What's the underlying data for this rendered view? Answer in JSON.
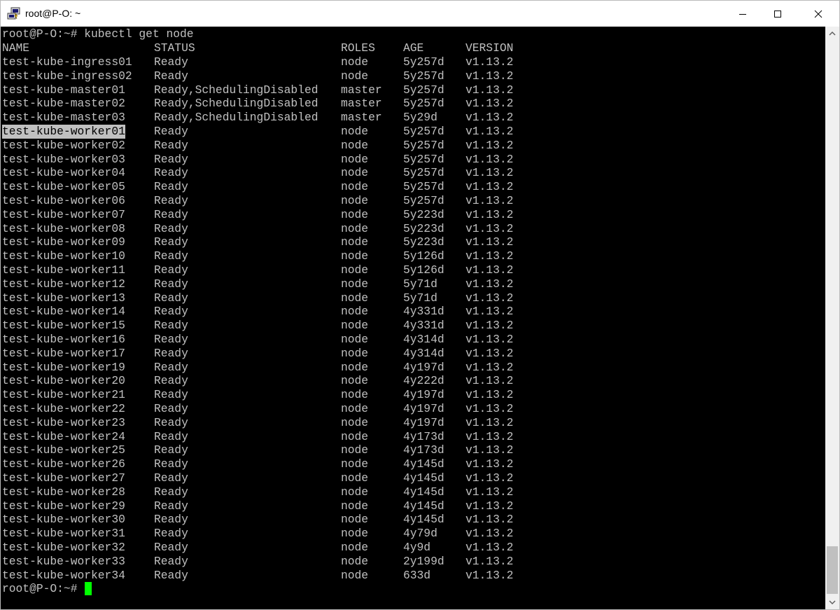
{
  "window": {
    "title": "root@P-O: ~"
  },
  "terminal": {
    "command_prompt": "root@P-O:~# ",
    "command": "kubectl get node",
    "headers": {
      "name": "NAME",
      "status": "STATUS",
      "roles": "ROLES",
      "age": "AGE",
      "version": "VERSION"
    },
    "rows": [
      {
        "name": "test-kube-ingress01",
        "status": "Ready",
        "roles": "node",
        "age": "5y257d",
        "version": "v1.13.2"
      },
      {
        "name": "test-kube-ingress02",
        "status": "Ready",
        "roles": "node",
        "age": "5y257d",
        "version": "v1.13.2"
      },
      {
        "name": "test-kube-master01",
        "status": "Ready,SchedulingDisabled",
        "roles": "master",
        "age": "5y257d",
        "version": "v1.13.2"
      },
      {
        "name": "test-kube-master02",
        "status": "Ready,SchedulingDisabled",
        "roles": "master",
        "age": "5y257d",
        "version": "v1.13.2"
      },
      {
        "name": "test-kube-master03",
        "status": "Ready,SchedulingDisabled",
        "roles": "master",
        "age": "5y29d",
        "version": "v1.13.2"
      },
      {
        "name": "test-kube-worker01",
        "status": "Ready",
        "roles": "node",
        "age": "5y257d",
        "version": "v1.13.2",
        "selected": true
      },
      {
        "name": "test-kube-worker02",
        "status": "Ready",
        "roles": "node",
        "age": "5y257d",
        "version": "v1.13.2"
      },
      {
        "name": "test-kube-worker03",
        "status": "Ready",
        "roles": "node",
        "age": "5y257d",
        "version": "v1.13.2"
      },
      {
        "name": "test-kube-worker04",
        "status": "Ready",
        "roles": "node",
        "age": "5y257d",
        "version": "v1.13.2"
      },
      {
        "name": "test-kube-worker05",
        "status": "Ready",
        "roles": "node",
        "age": "5y257d",
        "version": "v1.13.2"
      },
      {
        "name": "test-kube-worker06",
        "status": "Ready",
        "roles": "node",
        "age": "5y257d",
        "version": "v1.13.2"
      },
      {
        "name": "test-kube-worker07",
        "status": "Ready",
        "roles": "node",
        "age": "5y223d",
        "version": "v1.13.2"
      },
      {
        "name": "test-kube-worker08",
        "status": "Ready",
        "roles": "node",
        "age": "5y223d",
        "version": "v1.13.2"
      },
      {
        "name": "test-kube-worker09",
        "status": "Ready",
        "roles": "node",
        "age": "5y223d",
        "version": "v1.13.2"
      },
      {
        "name": "test-kube-worker10",
        "status": "Ready",
        "roles": "node",
        "age": "5y126d",
        "version": "v1.13.2"
      },
      {
        "name": "test-kube-worker11",
        "status": "Ready",
        "roles": "node",
        "age": "5y126d",
        "version": "v1.13.2"
      },
      {
        "name": "test-kube-worker12",
        "status": "Ready",
        "roles": "node",
        "age": "5y71d",
        "version": "v1.13.2"
      },
      {
        "name": "test-kube-worker13",
        "status": "Ready",
        "roles": "node",
        "age": "5y71d",
        "version": "v1.13.2"
      },
      {
        "name": "test-kube-worker14",
        "status": "Ready",
        "roles": "node",
        "age": "4y331d",
        "version": "v1.13.2"
      },
      {
        "name": "test-kube-worker15",
        "status": "Ready",
        "roles": "node",
        "age": "4y331d",
        "version": "v1.13.2"
      },
      {
        "name": "test-kube-worker16",
        "status": "Ready",
        "roles": "node",
        "age": "4y314d",
        "version": "v1.13.2"
      },
      {
        "name": "test-kube-worker17",
        "status": "Ready",
        "roles": "node",
        "age": "4y314d",
        "version": "v1.13.2"
      },
      {
        "name": "test-kube-worker19",
        "status": "Ready",
        "roles": "node",
        "age": "4y197d",
        "version": "v1.13.2"
      },
      {
        "name": "test-kube-worker20",
        "status": "Ready",
        "roles": "node",
        "age": "4y222d",
        "version": "v1.13.2"
      },
      {
        "name": "test-kube-worker21",
        "status": "Ready",
        "roles": "node",
        "age": "4y197d",
        "version": "v1.13.2"
      },
      {
        "name": "test-kube-worker22",
        "status": "Ready",
        "roles": "node",
        "age": "4y197d",
        "version": "v1.13.2"
      },
      {
        "name": "test-kube-worker23",
        "status": "Ready",
        "roles": "node",
        "age": "4y197d",
        "version": "v1.13.2"
      },
      {
        "name": "test-kube-worker24",
        "status": "Ready",
        "roles": "node",
        "age": "4y173d",
        "version": "v1.13.2"
      },
      {
        "name": "test-kube-worker25",
        "status": "Ready",
        "roles": "node",
        "age": "4y173d",
        "version": "v1.13.2"
      },
      {
        "name": "test-kube-worker26",
        "status": "Ready",
        "roles": "node",
        "age": "4y145d",
        "version": "v1.13.2"
      },
      {
        "name": "test-kube-worker27",
        "status": "Ready",
        "roles": "node",
        "age": "4y145d",
        "version": "v1.13.2"
      },
      {
        "name": "test-kube-worker28",
        "status": "Ready",
        "roles": "node",
        "age": "4y145d",
        "version": "v1.13.2"
      },
      {
        "name": "test-kube-worker29",
        "status": "Ready",
        "roles": "node",
        "age": "4y145d",
        "version": "v1.13.2"
      },
      {
        "name": "test-kube-worker30",
        "status": "Ready",
        "roles": "node",
        "age": "4y145d",
        "version": "v1.13.2"
      },
      {
        "name": "test-kube-worker31",
        "status": "Ready",
        "roles": "node",
        "age": "4y79d",
        "version": "v1.13.2"
      },
      {
        "name": "test-kube-worker32",
        "status": "Ready",
        "roles": "node",
        "age": "4y9d",
        "version": "v1.13.2"
      },
      {
        "name": "test-kube-worker33",
        "status": "Ready",
        "roles": "node",
        "age": "2y199d",
        "version": "v1.13.2"
      },
      {
        "name": "test-kube-worker34",
        "status": "Ready",
        "roles": "node",
        "age": "633d",
        "version": "v1.13.2"
      }
    ],
    "final_prompt": "root@P-O:~# "
  },
  "colors": {
    "terminal_bg": "#000000",
    "terminal_fg": "#c0c0c0",
    "selection_bg": "#c0c0c0",
    "cursor": "#00ff00"
  },
  "icons": {
    "app": "putty-icon",
    "minimize": "minimize-icon",
    "maximize": "maximize-icon",
    "close": "close-icon",
    "scroll_up": "scroll-up-arrow-icon",
    "scroll_down": "scroll-down-arrow-icon"
  }
}
